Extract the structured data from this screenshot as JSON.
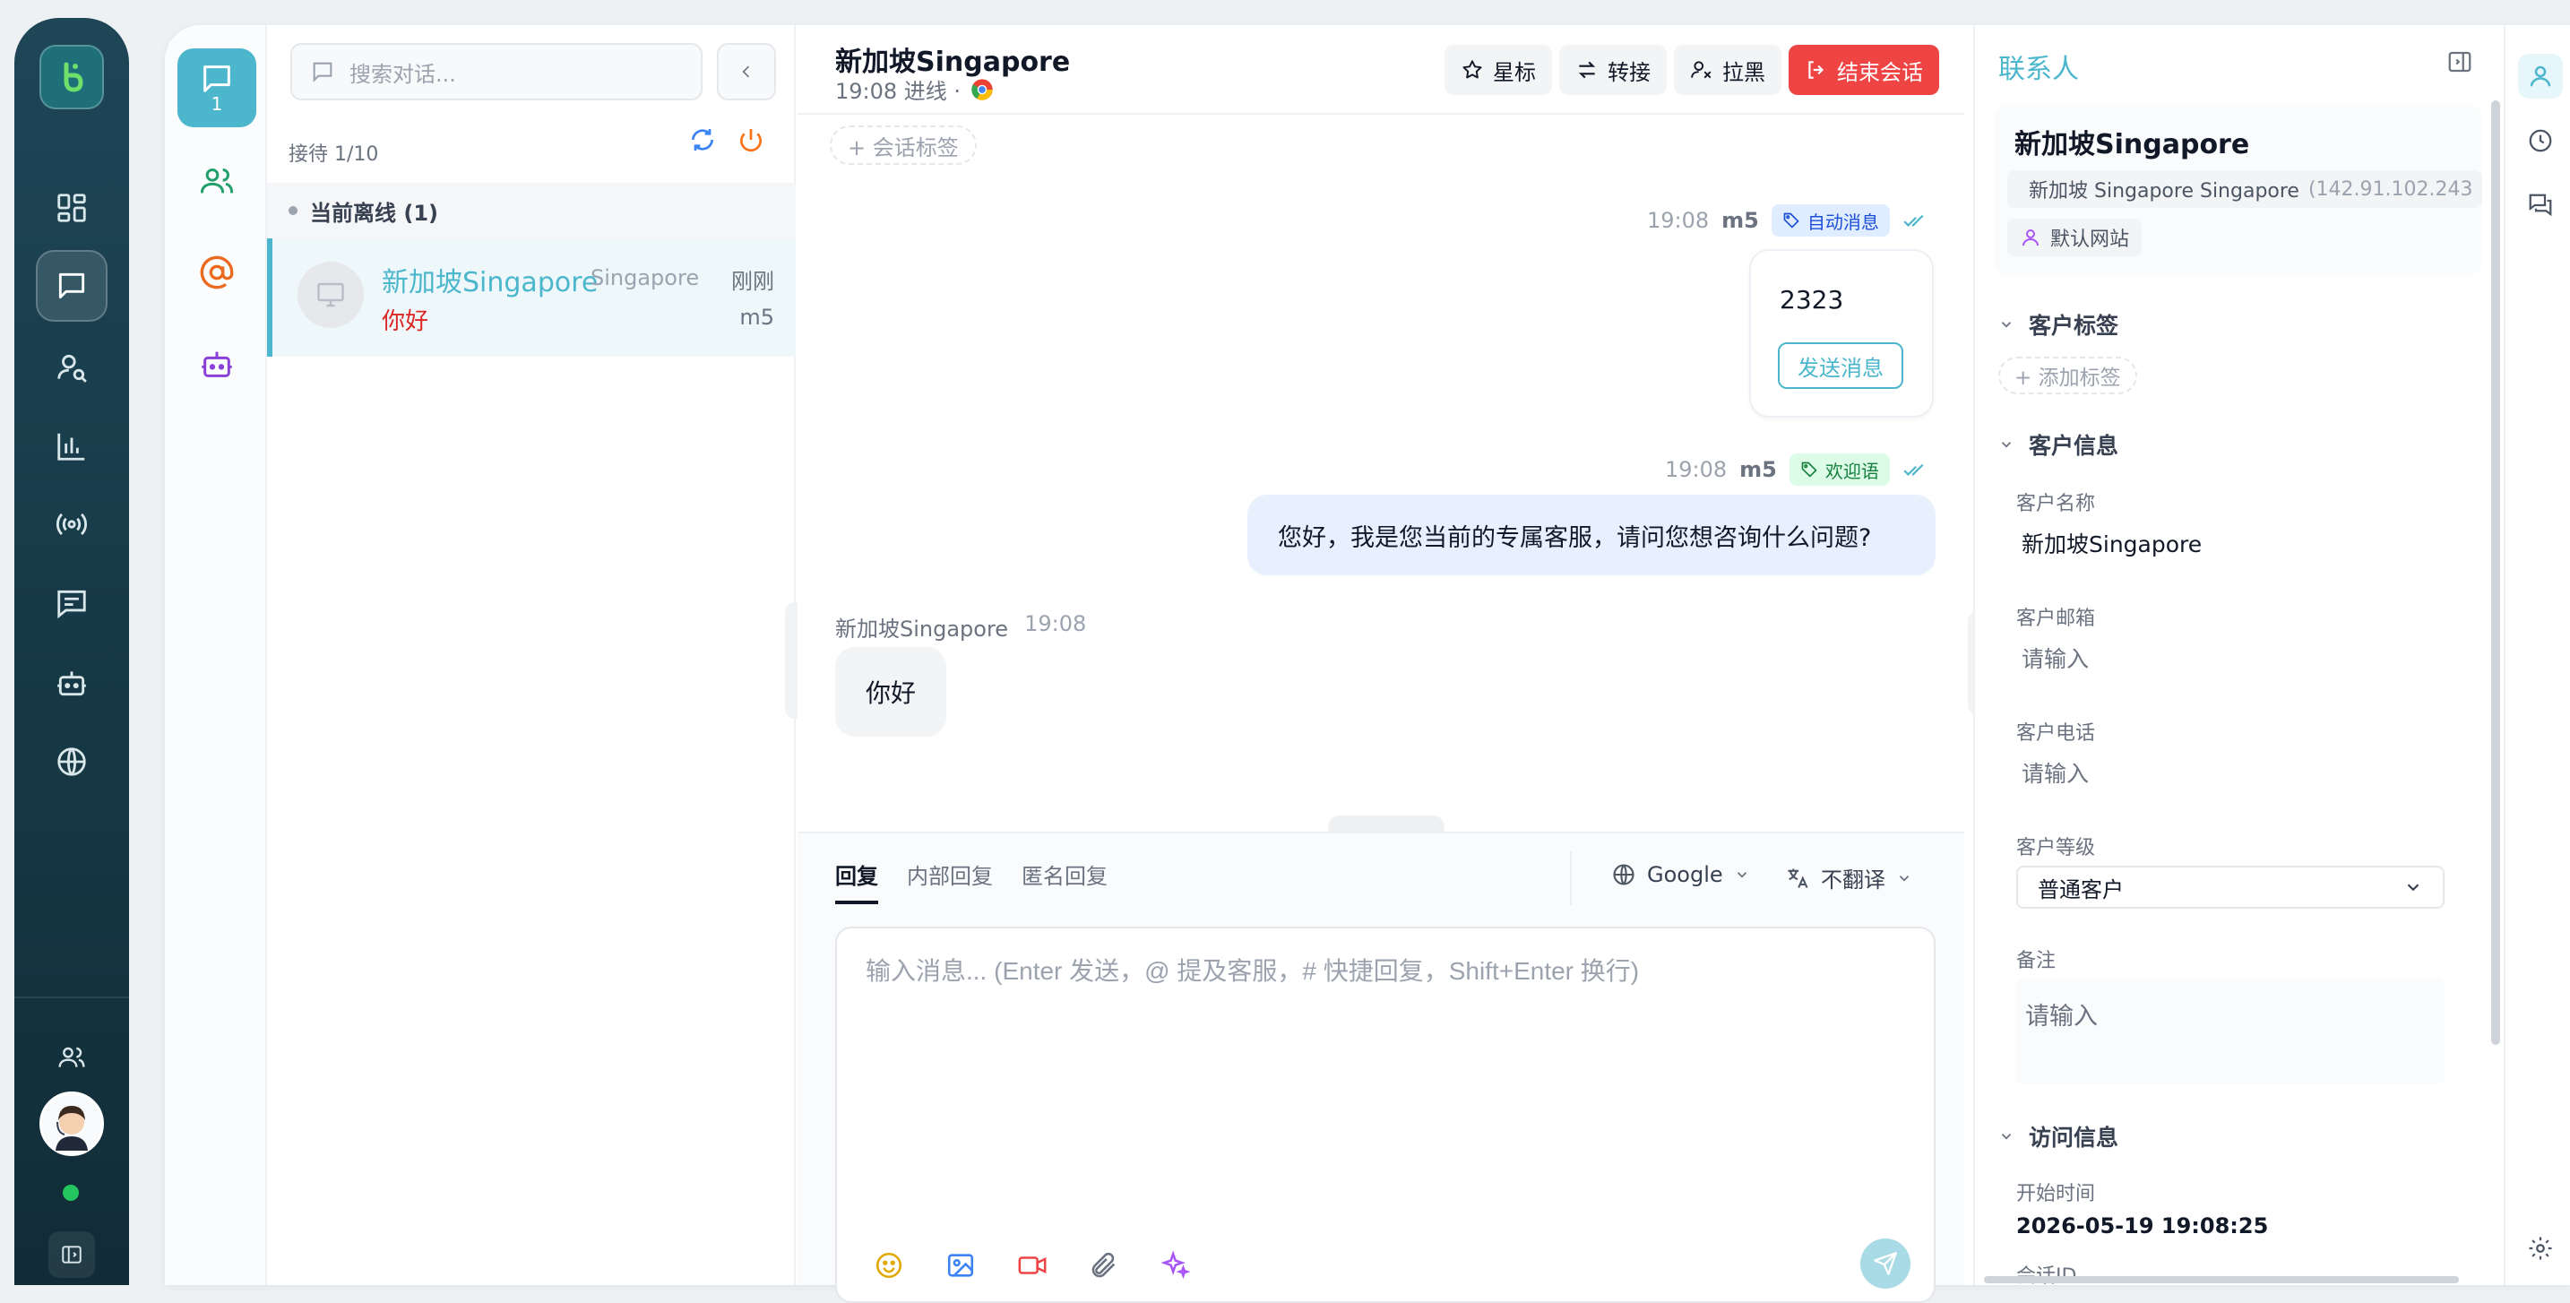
{
  "rail": {
    "logo_icon": "hand-logo-icon",
    "items": [
      {
        "name": "dashboard-icon"
      },
      {
        "name": "chat-icon",
        "active": true
      },
      {
        "name": "user-search-icon"
      },
      {
        "name": "bar-chart-icon"
      },
      {
        "name": "broadcast-icon"
      },
      {
        "name": "message-square-icon"
      },
      {
        "name": "bot-icon"
      },
      {
        "name": "globe-icon"
      }
    ],
    "bottom": [
      "team-icon",
      "avatar",
      "online-dot",
      "sidebar-toggle-icon"
    ]
  },
  "secnav": {
    "chat_count": "1",
    "items": [
      "chat-icon",
      "users-icon",
      "at-icon",
      "bot-icon"
    ]
  },
  "conversations": {
    "search_placeholder": "搜索对话...",
    "queue_label": "接待 1/10",
    "group_label": "当前离线 (1)",
    "item": {
      "name": "新加坡Singapore",
      "location": "Singapore",
      "time": "刚刚",
      "last_message": "你好",
      "agent": "m5"
    }
  },
  "chat": {
    "title": "新加坡Singapore",
    "subtitle": "19:08 进线 ·",
    "buttons": {
      "star": "星标",
      "transfer": "转接",
      "block": "拉黑",
      "end": "结束会话"
    },
    "add_tag": "+ 会话标签",
    "messages": [
      {
        "time": "19:08",
        "sender": "m5",
        "badge": "自动消息",
        "content": "2323",
        "button": "发送消息"
      },
      {
        "time": "19:08",
        "sender": "m5",
        "badge": "欢迎语",
        "content": "您好，我是您当前的专属客服，请问您想咨询什么问题?"
      },
      {
        "sender": "新加坡Singapore",
        "time": "19:08",
        "content": "你好"
      }
    ],
    "reply_tabs": [
      "回复",
      "内部回复",
      "匿名回复"
    ],
    "engine": "Google",
    "translate": "不翻译",
    "composer_placeholder": "输入消息... (Enter 发送，@ 提及客服，# 快捷回复，Shift+Enter 换行)",
    "toolbar_icons": [
      "emoji-icon",
      "image-icon",
      "video-icon",
      "attachment-icon",
      "ai-sparkle-icon"
    ],
    "colors": {
      "accent": "#4bb6cc",
      "danger": "#ef4444"
    }
  },
  "contact": {
    "title": "联系人",
    "name": "新加坡Singapore",
    "location": "新加坡 Singapore Singapore",
    "ip": "(142.91.102.243",
    "site": "默认网站",
    "tags_section": "客户标签",
    "add_tag": "+ 添加标签",
    "info_section": "客户信息",
    "fields": {
      "name_label": "客户名称",
      "name_value": "新加坡Singapore",
      "email_label": "客户邮箱",
      "email_placeholder": "请输入",
      "phone_label": "客户电话",
      "phone_placeholder": "请输入",
      "level_label": "客户等级",
      "level_value": "普通客户",
      "note_label": "备注",
      "note_placeholder": "请输入"
    },
    "visit_section": "访问信息",
    "start_label": "开始时间",
    "start_value": "2026-05-19 19:08:25",
    "session_label": "会话ID"
  }
}
